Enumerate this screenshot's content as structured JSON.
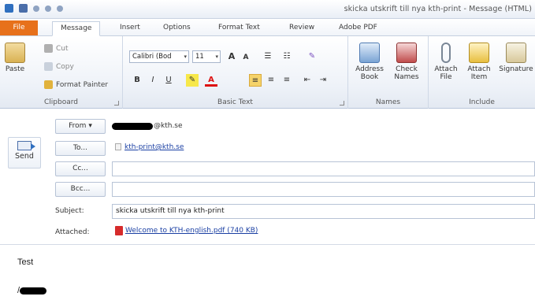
{
  "window": {
    "title": "skicka utskrift till nya kth-print - Message (HTML)"
  },
  "tabs": [
    {
      "label": "File"
    },
    {
      "label": "Message"
    },
    {
      "label": "Insert"
    },
    {
      "label": "Options"
    },
    {
      "label": "Format Text"
    },
    {
      "label": "Review"
    },
    {
      "label": "Adobe PDF"
    }
  ],
  "ribbon": {
    "clipboard": {
      "paste": "Paste",
      "cut": "Cut",
      "copy": "Copy",
      "format_painter": "Format Painter",
      "label": "Clipboard"
    },
    "basic_text": {
      "font": "Calibri (Bod",
      "size": "11",
      "bold": "B",
      "italic": "I",
      "underline": "U",
      "label": "Basic Text"
    },
    "names": {
      "address_book": "Address Book",
      "check_names": "Check Names",
      "label": "Names"
    },
    "include": {
      "attach_file": "Attach File",
      "attach_item": "Attach Item",
      "signature": "Signature",
      "label": "Include"
    }
  },
  "compose": {
    "send": "Send",
    "from_button": "From",
    "from_domain": "@kth.se",
    "to_button": "To...",
    "to_value": "kth-print@kth.se",
    "cc_button": "Cc...",
    "cc_value": "",
    "bcc_button": "Bcc...",
    "bcc_value": "",
    "subject_label": "Subject:",
    "subject_value": "skicka utskrift till nya kth-print",
    "attached_label": "Attached:",
    "attachment": "Welcome to KTH-english.pdf (740 KB)"
  },
  "body": {
    "text": "Test",
    "sig_prefix": "/"
  },
  "colors": {
    "file_tab": "#e7711b",
    "link": "#1a3fa3"
  }
}
